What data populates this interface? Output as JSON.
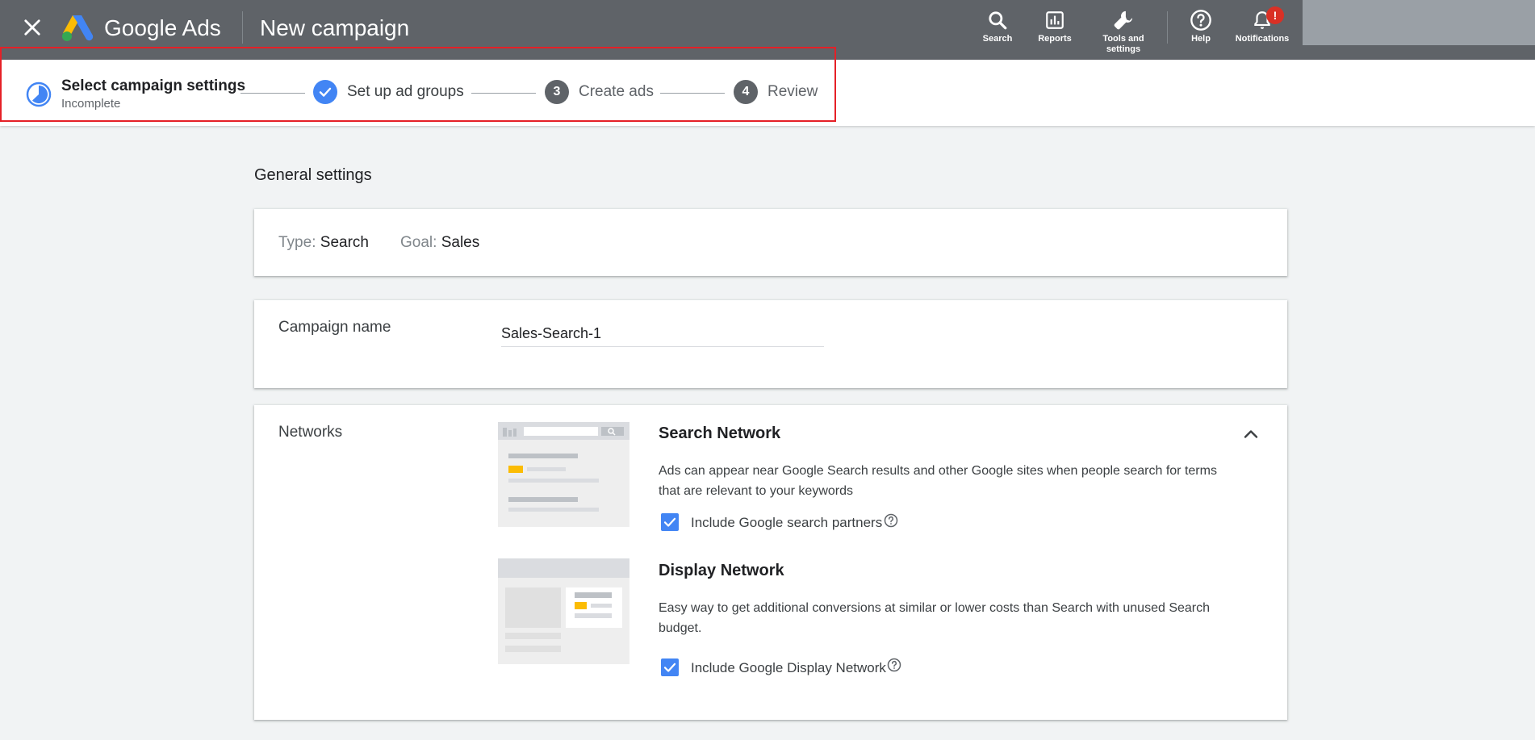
{
  "header": {
    "brand": "Google Ads",
    "page_title": "New campaign",
    "tools": [
      {
        "label": "Search",
        "icon": "search-icon"
      },
      {
        "label": "Reports",
        "icon": "reports-icon"
      },
      {
        "label": "Tools and settings",
        "icon": "wrench-icon"
      },
      {
        "label": "Help",
        "icon": "help-icon"
      },
      {
        "label": "Notifications",
        "icon": "bell-icon",
        "badge": "!"
      }
    ]
  },
  "stepper": {
    "steps": [
      {
        "label": "Select campaign settings",
        "sub": "Incomplete",
        "state": "in-progress"
      },
      {
        "label": "Set up ad groups",
        "state": "complete"
      },
      {
        "label": "Create ads",
        "number": "3",
        "state": "pending"
      },
      {
        "label": "Review",
        "number": "4",
        "state": "pending"
      }
    ]
  },
  "general_settings": {
    "title": "General settings",
    "type_label": "Type:",
    "type_value": "Search",
    "goal_label": "Goal:",
    "goal_value": "Sales"
  },
  "campaign_name": {
    "label": "Campaign name",
    "value": "Sales-Search-1"
  },
  "networks": {
    "label": "Networks",
    "search": {
      "title": "Search Network",
      "description": "Ads can appear near Google Search results and other Google sites when people search for terms that are relevant to your keywords",
      "checkbox_label": "Include Google search partners",
      "checked": true
    },
    "display": {
      "title": "Display Network",
      "description": "Easy way to get additional conversions at similar or lower costs than Search with unused Search budget.",
      "checkbox_label": "Include Google Display Network",
      "checked": true
    }
  },
  "colors": {
    "topbar": "#5f6368",
    "accent": "#4285f4",
    "highlight": "#e52027",
    "badge": "#d93025",
    "ad_yellow": "#fbbc04"
  }
}
